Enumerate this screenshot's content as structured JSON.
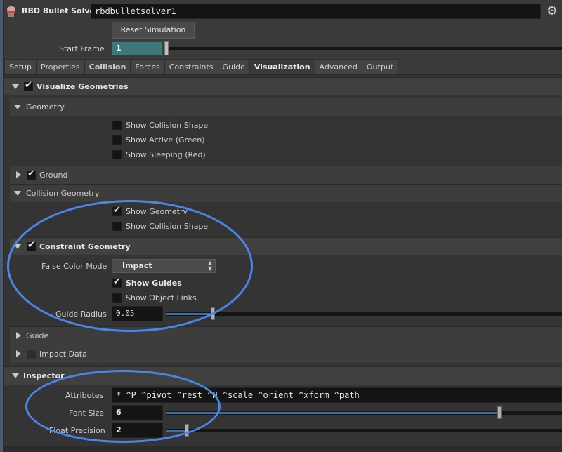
{
  "header": {
    "node_type": "RBD Bullet Solver",
    "node_name": "rbdbulletsolver1"
  },
  "reset_label": "Reset Simulation",
  "start_frame": {
    "label": "Start Frame",
    "value": "1"
  },
  "tabs": [
    {
      "label": "Setup"
    },
    {
      "label": "Properties"
    },
    {
      "label": "Collision"
    },
    {
      "label": "Forces"
    },
    {
      "label": "Constraints"
    },
    {
      "label": "Guide"
    },
    {
      "label": "Visualization"
    },
    {
      "label": "Advanced"
    },
    {
      "label": "Output"
    }
  ],
  "active_tab": "Visualization",
  "visualize": {
    "label": "Visualize Geometries",
    "checked": true
  },
  "geometry": {
    "label": "Geometry",
    "show_collision_shape": "Show Collision Shape",
    "show_active": "Show Active (Green)",
    "show_sleeping": "Show Sleeping (Red)"
  },
  "ground": {
    "label": "Ground",
    "checked": true
  },
  "collision_geometry": {
    "label": "Collision Geometry",
    "show_geometry": "Show Geometry",
    "show_collision_shape": "Show Collision Shape"
  },
  "constraint_geometry": {
    "label": "Constraint Geometry",
    "false_color_label": "False Color Mode",
    "false_color_value": "Impact",
    "show_guides": "Show Guides",
    "show_object_links": "Show Object Links",
    "guide_radius_label": "Guide Radius",
    "guide_radius_value": "0.05"
  },
  "guide": {
    "label": "Guide"
  },
  "impact_data": {
    "label": "Impact Data"
  },
  "inspector": {
    "label": "Inspector",
    "attributes_label": "Attributes",
    "attributes_value": "* ^P ^pivot ^rest ^N ^scale ^orient ^xform ^path",
    "font_size_label": "Font Size",
    "font_size_value": "6",
    "float_precision_label": "Float Precision",
    "float_precision_value": "2"
  },
  "colors": {
    "accent": "#4a86e8",
    "start_field": "#3e7777",
    "slider_fill": "#3e6ea8"
  }
}
